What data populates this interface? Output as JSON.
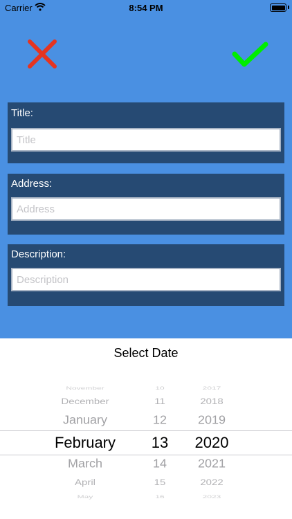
{
  "status_bar": {
    "carrier": "Carrier",
    "time": "8:54 PM"
  },
  "actions": {
    "cancel_icon": "close-icon",
    "confirm_icon": "checkmark-icon"
  },
  "form": {
    "title": {
      "label": "Title:",
      "placeholder": "Title",
      "value": ""
    },
    "address": {
      "label": "Address:",
      "placeholder": "Address",
      "value": ""
    },
    "description": {
      "label": "Description:",
      "placeholder": "Description",
      "value": ""
    }
  },
  "picker": {
    "title": "Select Date",
    "months": [
      "November",
      "December",
      "January",
      "February",
      "March",
      "April",
      "May"
    ],
    "days": [
      "10",
      "11",
      "12",
      "13",
      "14",
      "15",
      "16"
    ],
    "years": [
      "2017",
      "2018",
      "2019",
      "2020",
      "2021",
      "2022",
      "2023"
    ],
    "selected": {
      "month": "February",
      "day": "13",
      "year": "2020"
    }
  },
  "colors": {
    "background": "#4a90e2",
    "panel": "#264a73",
    "cancel": "#e53421",
    "confirm": "#00ee00",
    "picker_background": "#ffffff"
  }
}
